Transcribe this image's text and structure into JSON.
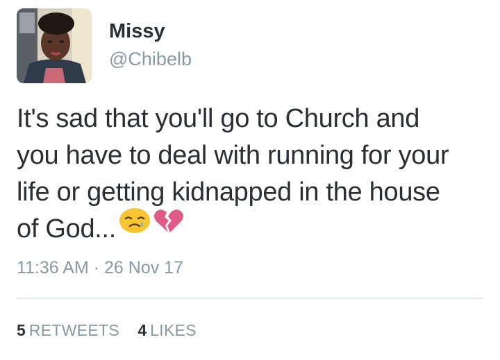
{
  "author": {
    "display_name": "Missy",
    "handle": "@Chibelb"
  },
  "tweet": {
    "lines": [
      "It's sad that you'll go to Church and",
      "you have to deal with running for your",
      "life or getting kidnapped in the house",
      "of God..."
    ],
    "emojis": [
      "sad-crying-face-icon",
      "broken-heart-icon"
    ]
  },
  "meta": {
    "time": "11:36 AM",
    "separator": "·",
    "date": "26 Nov 17"
  },
  "stats": {
    "retweets_count": "5",
    "retweets_label": "RETWEETS",
    "likes_count": "4",
    "likes_label": "LIKES"
  },
  "colors": {
    "text": "#292f33",
    "muted": "#8899a6",
    "divider": "#e1e8ed",
    "emoji_face": "#f7c531",
    "emoji_heart": "#e05a86"
  }
}
